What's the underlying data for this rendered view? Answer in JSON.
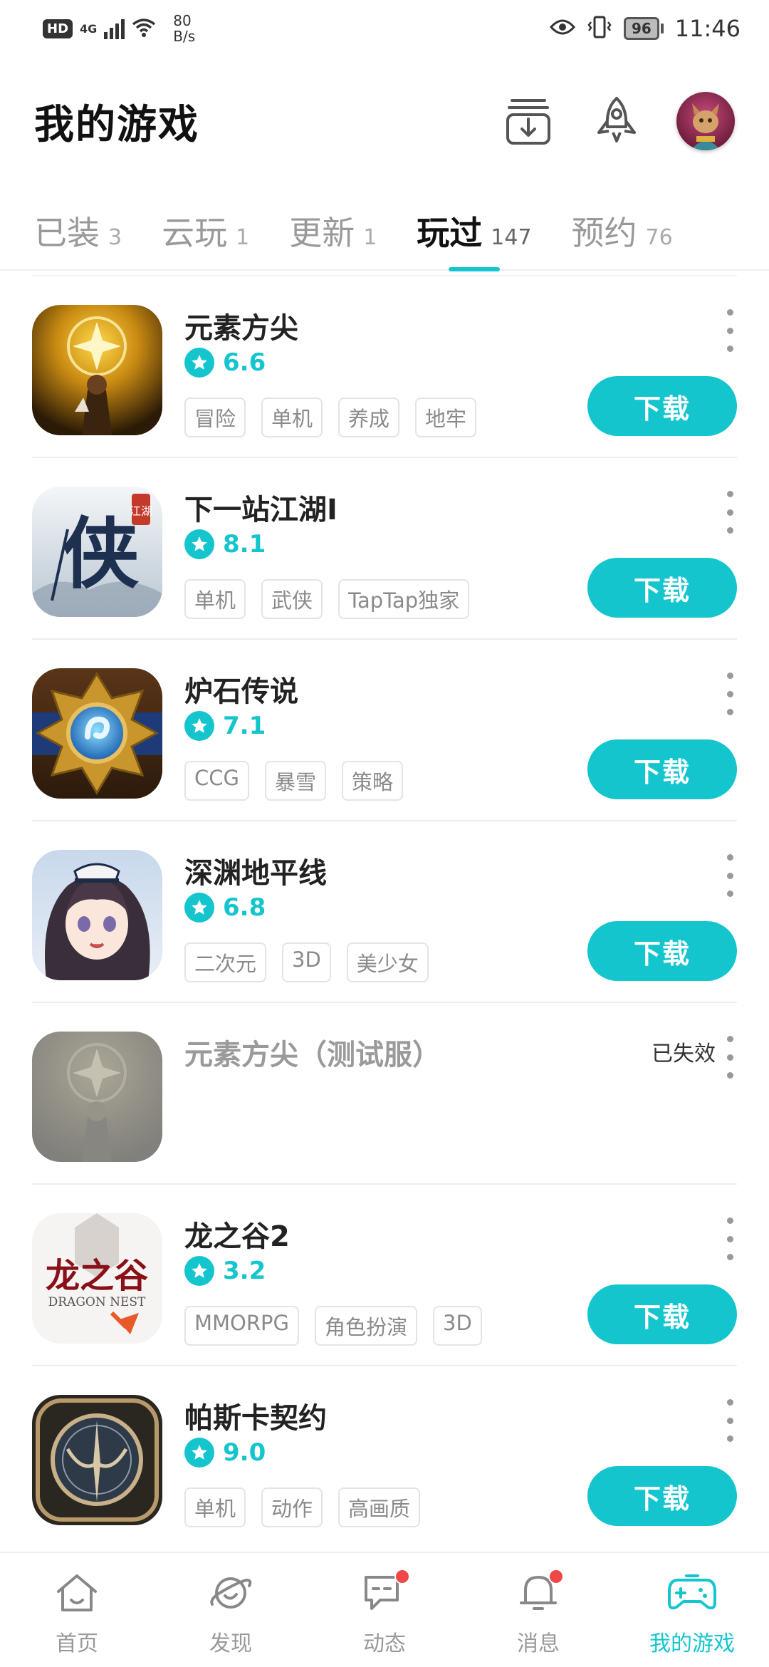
{
  "status_bar": {
    "hd": "HD",
    "network": "4G",
    "speed_value": "80",
    "speed_unit": "B/s",
    "battery": "96",
    "time": "11:46"
  },
  "header": {
    "title": "我的游戏"
  },
  "tabs": [
    {
      "label": "已装",
      "count": "3"
    },
    {
      "label": "云玩",
      "count": "1"
    },
    {
      "label": "更新",
      "count": "1"
    },
    {
      "label": "玩过",
      "count": "147",
      "active": true
    },
    {
      "label": "预约",
      "count": "76"
    }
  ],
  "games": [
    {
      "name": "元素方尖",
      "rating": "6.6",
      "tags": [
        "冒险",
        "单机",
        "养成",
        "地牢"
      ],
      "action": "下载"
    },
    {
      "name": "下一站江湖Ⅰ",
      "rating": "8.1",
      "tags": [
        "单机",
        "武侠",
        "TapTap独家"
      ],
      "action": "下载"
    },
    {
      "name": "炉石传说",
      "rating": "7.1",
      "tags": [
        "CCG",
        "暴雪",
        "策略"
      ],
      "action": "下载"
    },
    {
      "name": "深渊地平线",
      "rating": "6.8",
      "tags": [
        "二次元",
        "3D",
        "美少女"
      ],
      "action": "下载"
    },
    {
      "name": "元素方尖（测试服）",
      "status": "已失效"
    },
    {
      "name": "龙之谷2",
      "rating": "3.2",
      "tags": [
        "MMORPG",
        "角色扮演",
        "3D"
      ],
      "action": "下载"
    },
    {
      "name": "帕斯卡契约",
      "rating": "9.0",
      "tags": [
        "单机",
        "动作",
        "高画质"
      ],
      "action": "下载"
    }
  ],
  "icon_text": {
    "xia": "侠",
    "jianghu": "江湖",
    "longzhigu": "龙之谷",
    "dragon_nest": "DRAGON NEST"
  },
  "bottom_nav": [
    {
      "label": "首页",
      "icon": "home-icon"
    },
    {
      "label": "发现",
      "icon": "planet-icon"
    },
    {
      "label": "动态",
      "icon": "chat-icon",
      "badge": true
    },
    {
      "label": "消息",
      "icon": "bell-icon",
      "badge": true
    },
    {
      "label": "我的游戏",
      "icon": "gamepad-icon",
      "active": true
    }
  ],
  "colors": {
    "accent": "#15c5ce",
    "badge": "#f04848",
    "tag_text": "#8a8a8a",
    "muted": "#999999"
  }
}
